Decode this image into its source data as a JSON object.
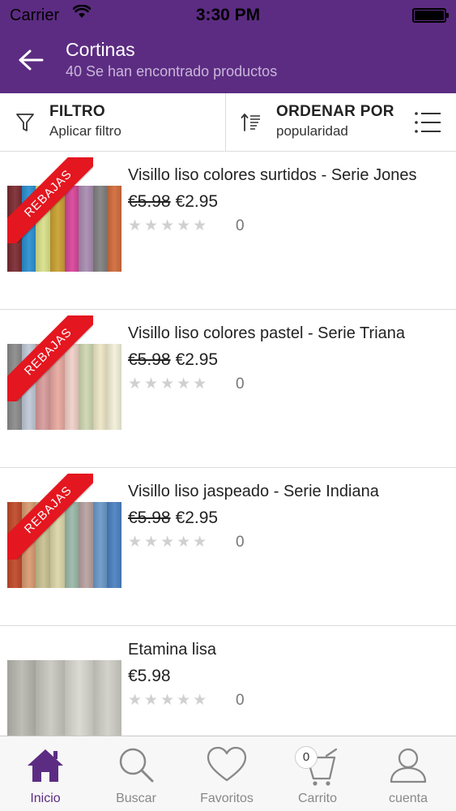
{
  "status_bar": {
    "carrier": "Carrier",
    "time": "3:30 PM"
  },
  "header": {
    "title": "Cortinas",
    "subtitle": "40 Se han encontrado productos"
  },
  "toolbar": {
    "filter_title": "FILTRO",
    "filter_sub": "Aplicar filtro",
    "sort_title": "ORDENAR POR",
    "sort_sub": "popularidad"
  },
  "products": [
    {
      "name": "Visillo liso colores surtidos - Serie Jones",
      "old_price": "€5.98",
      "price": "€2.95",
      "ribbon": "REBAJAS",
      "rating_count": "0",
      "swatches": [
        "#7a2a30",
        "#2a8fd0",
        "#d9e08a",
        "#c9a030",
        "#d8449a",
        "#a88bb0",
        "#808080",
        "#d06a3a"
      ]
    },
    {
      "name": "Visillo liso colores pastel - Serie Triana",
      "old_price": "€5.98",
      "price": "€2.95",
      "ribbon": "REBAJAS",
      "rating_count": "0",
      "swatches": [
        "#8a8a8a",
        "#c0c8d6",
        "#d89a9a",
        "#e8a8a0",
        "#f0d0c8",
        "#cdd6b0",
        "#eee6c6",
        "#f2f0d8"
      ]
    },
    {
      "name": "Visillo liso jaspeado - Serie Indiana",
      "old_price": "€5.98",
      "price": "€2.95",
      "ribbon": "REBAJAS",
      "rating_count": "0",
      "swatches": [
        "#c04828",
        "#d89a70",
        "#c8c090",
        "#dcd6a8",
        "#9ab8a8",
        "#b8a0a0",
        "#6a98c8",
        "#4a80c0"
      ]
    },
    {
      "name": "Etamina lisa",
      "old_price": "",
      "price": "€5.98",
      "ribbon": "",
      "rating_count": "0",
      "swatches": [
        "#b8b8b0",
        "#c8c8c0",
        "#d8d8d0",
        "#cfcfc6"
      ]
    }
  ],
  "tabbar": {
    "tabs": [
      {
        "label": "Inicio",
        "icon": "home-icon",
        "active": true
      },
      {
        "label": "Buscar",
        "icon": "search-icon",
        "active": false
      },
      {
        "label": "Favoritos",
        "icon": "heart-icon",
        "active": false
      },
      {
        "label": "Carrito",
        "icon": "cart-icon",
        "active": false
      },
      {
        "label": "cuenta",
        "icon": "user-icon",
        "active": false
      }
    ],
    "cart_count": "0"
  },
  "colors": {
    "brand": "#5c2c82",
    "ribbon": "#e4161f",
    "subtitle": "#c9b6da"
  }
}
